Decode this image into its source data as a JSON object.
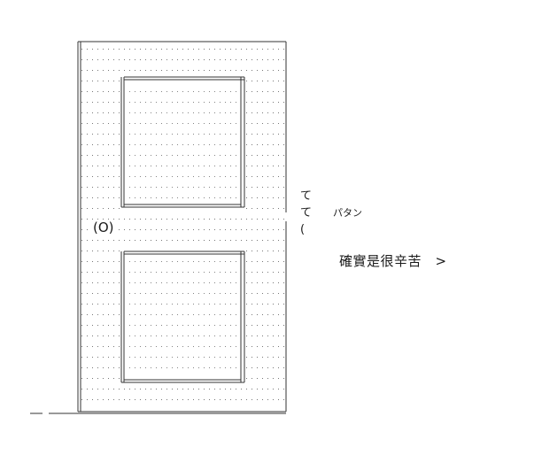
{
  "art": {
    "knob": "(O)",
    "side_glyphs": [
      "て",
      "て",
      "("
    ],
    "sound_effect": "パタン",
    "caption": "確實是很辛苦　>"
  }
}
